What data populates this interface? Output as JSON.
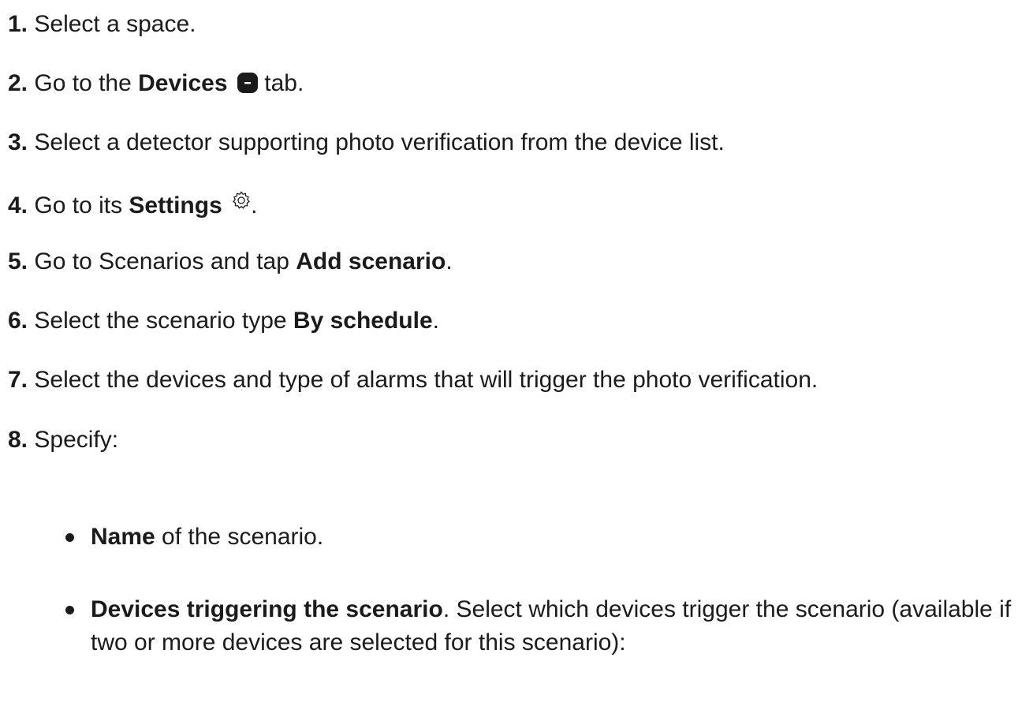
{
  "steps": [
    {
      "num": "1.",
      "pre": "Select a space."
    },
    {
      "num": "2.",
      "pre": "Go to the ",
      "bold": "Devices",
      "post": " tab.",
      "icon": "devices-tab-icon"
    },
    {
      "num": "3.",
      "pre": "Select a detector supporting photo verification from the device list."
    },
    {
      "num": "4.",
      "pre": "Go to its ",
      "bold": "Settings",
      "post": ".",
      "icon": "gear-icon"
    },
    {
      "num": "5.",
      "pre": "Go to Scenarios and tap ",
      "bold": "Add scenario",
      "post": "."
    },
    {
      "num": "6.",
      "pre": "Select the scenario type ",
      "bold": "By schedule",
      "post": "."
    },
    {
      "num": "7.",
      "pre": "Select the devices and type of alarms that will trigger the photo verification."
    },
    {
      "num": "8.",
      "pre": "Specify:"
    }
  ],
  "bullets": [
    {
      "bold": "Name",
      "post": " of the scenario."
    },
    {
      "bold": "Devices triggering the scenario",
      "post": ". Select which devices trigger the scenario (available if two or more devices are selected for this scenario):"
    }
  ],
  "colors": {
    "text": "#1b1b1b",
    "background": "#ffffff"
  }
}
